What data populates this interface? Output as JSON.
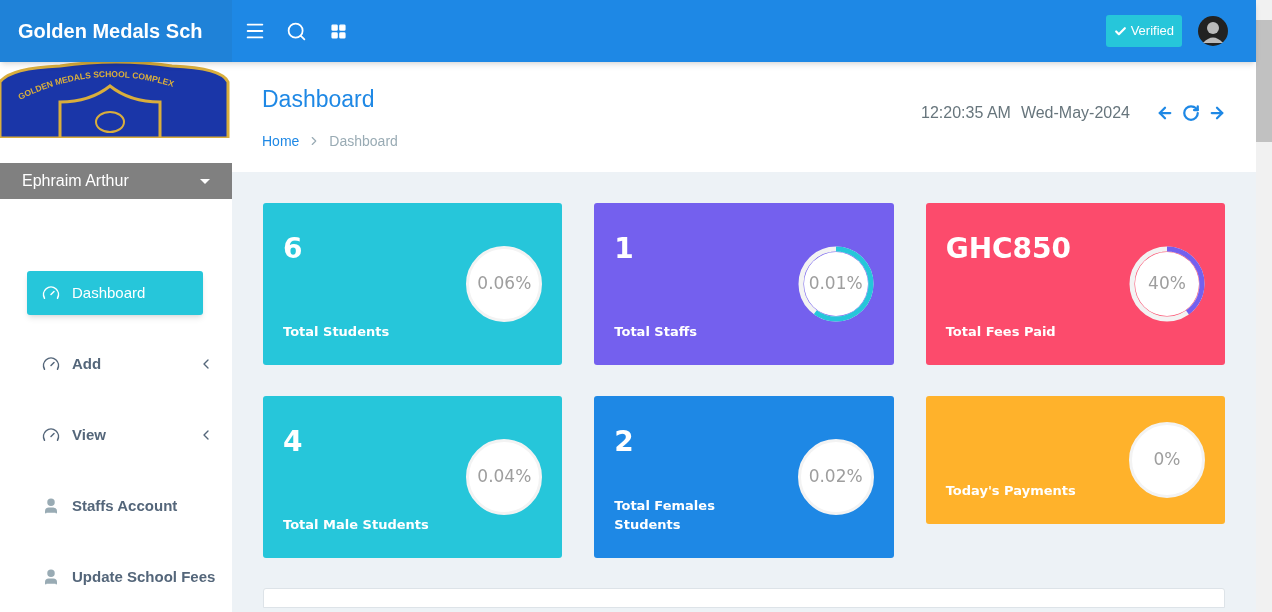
{
  "brand": "Golden Medals Sch",
  "logo_text": "GOLDEN MEDALS SCHOOL COMPLEX",
  "verified": "Verified",
  "user": {
    "name": "Ephraim Arthur"
  },
  "sidebar": {
    "items": [
      {
        "label": "Dashboard",
        "kind": "gauge",
        "selected": true,
        "expandable": false
      },
      {
        "label": "Add",
        "kind": "gauge",
        "selected": false,
        "expandable": true
      },
      {
        "label": "View",
        "kind": "gauge",
        "selected": false,
        "expandable": true
      },
      {
        "label": "Staffs Account",
        "kind": "user",
        "selected": false,
        "expandable": false
      },
      {
        "label": "Update School Fees",
        "kind": "user",
        "selected": false,
        "expandable": false
      }
    ]
  },
  "page": {
    "title": "Dashboard",
    "breadcrumb": [
      "Home",
      "Dashboard"
    ],
    "time": "12:20:35 AM",
    "date": "Wed-May-2024"
  },
  "cards": [
    {
      "value": "6",
      "label": "Total Students",
      "percent": "0.06%",
      "color": "#26c6da"
    },
    {
      "value": "1",
      "label": "Total Staffs",
      "percent": "0.01%",
      "level": 0.6,
      "color": "#7460ee"
    },
    {
      "value": "GHC850",
      "label": "Total Fees Paid",
      "percent": "40%",
      "level": 0.4,
      "color": "#fc4b6c"
    },
    {
      "value": "4",
      "label": "Total Male Students",
      "percent": "0.04%",
      "color": "#26c6da"
    },
    {
      "value": "2",
      "label": "Total Females Students",
      "percent": "0.02%",
      "color": "#1e88e5"
    },
    {
      "label": "Today's Payments",
      "percent": "0%",
      "color": "#ffb22b"
    }
  ]
}
